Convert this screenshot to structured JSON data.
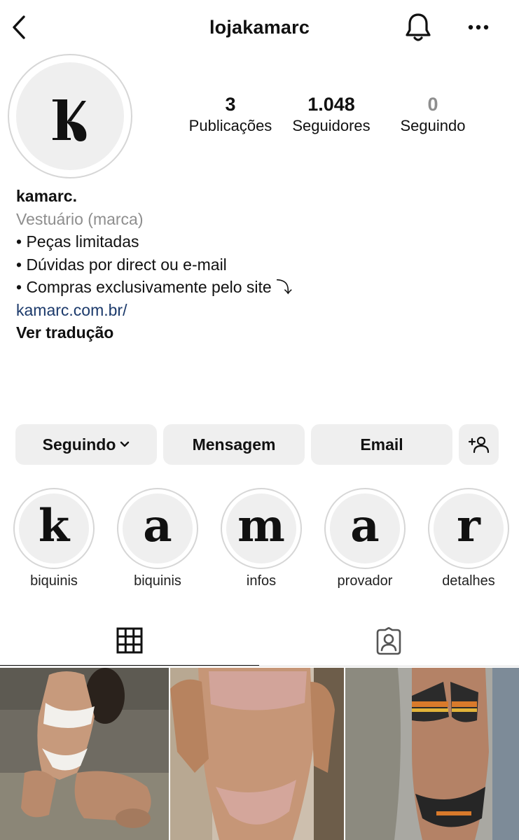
{
  "header": {
    "username": "lojakamarc",
    "back_icon": "back-arrow-icon",
    "bell_icon": "bell-icon",
    "more_icon": "more-horizontal-icon"
  },
  "profile": {
    "avatar_logo": "K",
    "stats": {
      "posts": {
        "value": "3",
        "label": "Publicações"
      },
      "followers": {
        "value": "1.048",
        "label": "Seguidores"
      },
      "following": {
        "value": "0",
        "label": "Seguindo"
      }
    }
  },
  "bio": {
    "name": "kamarc.",
    "category": "Vestuário (marca)",
    "lines": [
      "• Peças limitadas",
      "• Dúvidas por direct ou e-mail",
      "• Compras exclusivamente pelo site ⤵"
    ],
    "link": "kamarc.com.br/",
    "translate_label": "Ver tradução"
  },
  "actions": {
    "following_label": "Seguindo",
    "message_label": "Mensagem",
    "email_label": "Email",
    "add_user_icon": "add-user-icon"
  },
  "highlights": [
    {
      "letter": "k",
      "label": "biquinis"
    },
    {
      "letter": "a",
      "label": "biquinis"
    },
    {
      "letter": "m",
      "label": "infos"
    },
    {
      "letter": "a",
      "label": "provador"
    },
    {
      "letter": "r",
      "label": "detalhes"
    }
  ],
  "tabs": [
    {
      "icon": "grid-icon",
      "active": true
    },
    {
      "icon": "tagged-icon",
      "active": false
    }
  ],
  "colors": {
    "text": "#111111",
    "muted": "#8e8e8e",
    "link": "#1c3a6b",
    "button_bg": "#efefef",
    "divider": "#dbdbdb"
  }
}
